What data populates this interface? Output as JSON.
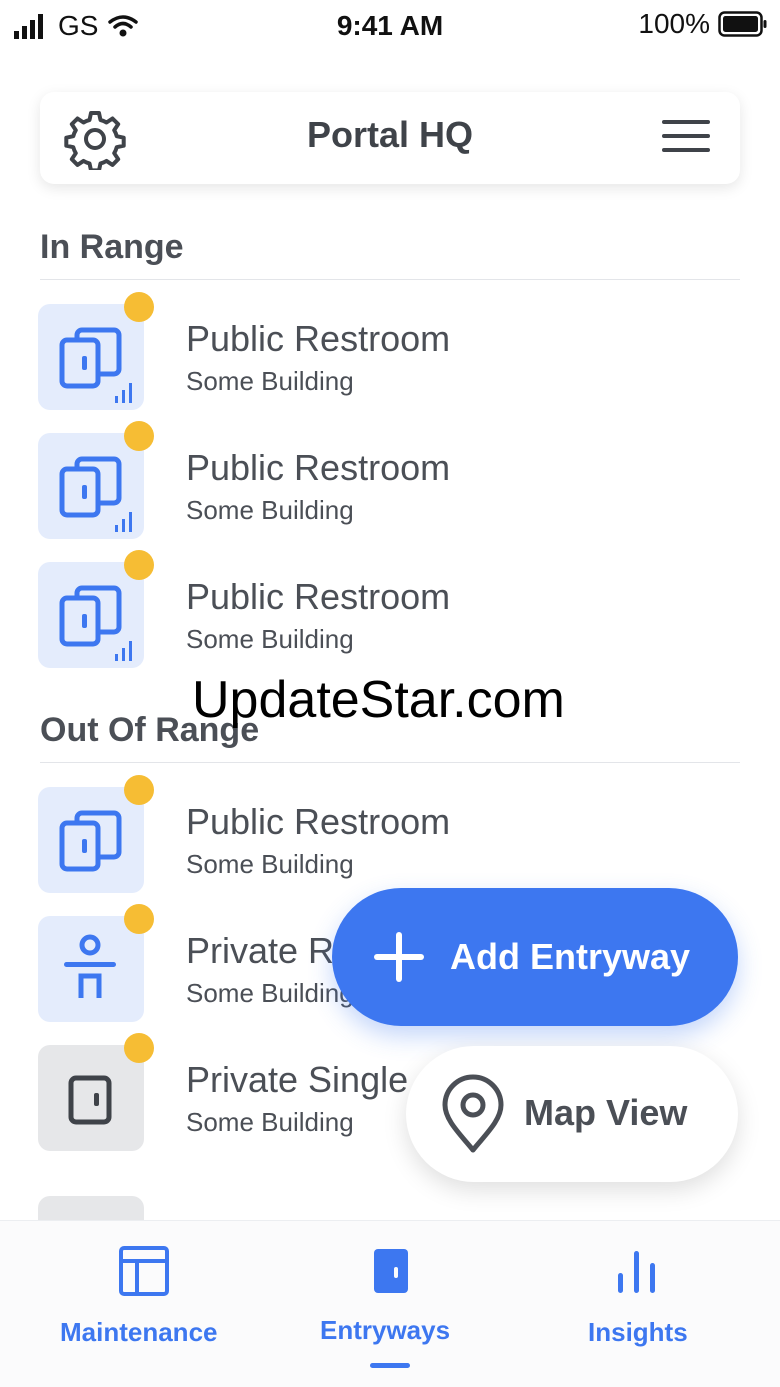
{
  "status_bar": {
    "carrier": "GS",
    "time": "9:41 AM",
    "battery": "100%"
  },
  "header": {
    "title": "Portal HQ",
    "settings_icon": "gear-icon",
    "menu_icon": "hamburger-menu-icon"
  },
  "sections": {
    "in_range": {
      "title": "In Range",
      "items": [
        {
          "title": "Public Restroom",
          "subtitle": "Some Building",
          "icon": "double-door-signal-icon"
        },
        {
          "title": "Public Restroom",
          "subtitle": "Some Building",
          "icon": "double-door-signal-icon"
        },
        {
          "title": "Public Restroom",
          "subtitle": "Some Building",
          "icon": "double-door-signal-icon"
        }
      ]
    },
    "out_of_range": {
      "title": "Out Of Range",
      "items": [
        {
          "title": "Public Restroom",
          "subtitle": "Some Building",
          "icon": "double-door-icon"
        },
        {
          "title": "Private Re",
          "subtitle": "Some Building",
          "icon": "person-icon"
        },
        {
          "title": "Private Single",
          "subtitle": "Some Building",
          "icon": "door-icon"
        }
      ]
    }
  },
  "watermark": "UpdateStar.com",
  "fab": {
    "add_label": "Add Entryway",
    "map_label": "Map View"
  },
  "bottom_nav": {
    "items": [
      {
        "label": "Maintenance",
        "icon": "layout-icon"
      },
      {
        "label": "Entryways",
        "icon": "door-icon",
        "active": true
      },
      {
        "label": "Insights",
        "icon": "bar-chart-icon"
      }
    ]
  },
  "colors": {
    "accent": "#3d77f0",
    "badge": "#f6bd34",
    "tile_blue": "#e4ecfc",
    "tile_grey": "#e6e7e9",
    "text": "#4b4f56"
  }
}
